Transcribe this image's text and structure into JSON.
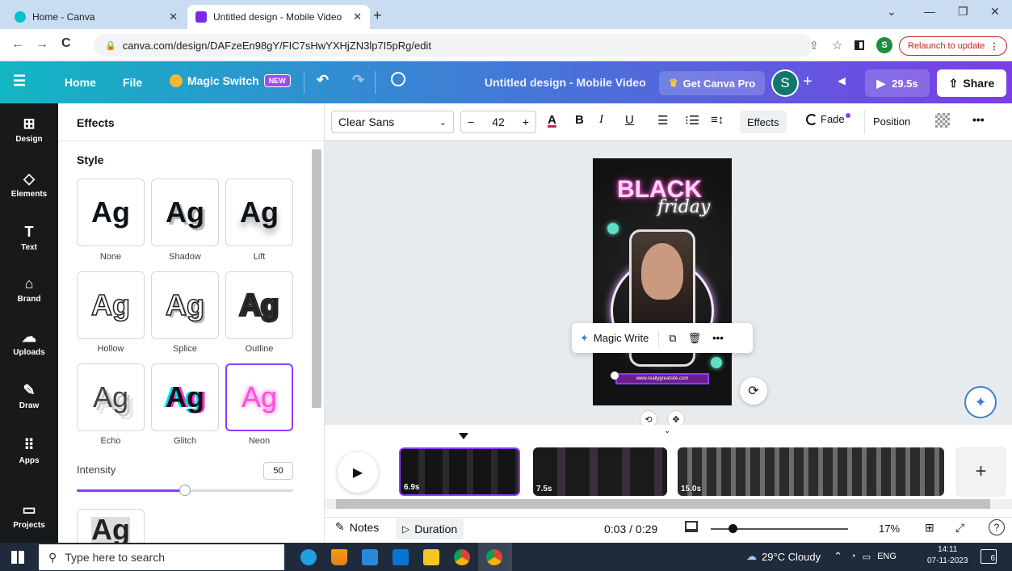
{
  "browser": {
    "tabs": [
      {
        "title": "Home - Canva"
      },
      {
        "title": "Untitled design - Mobile Video"
      }
    ],
    "url": "canva.com/design/DAFzeEn98gY/FIC7sHwYXHjZN3lp7I5pRg/edit",
    "relaunch": "Relaunch to update",
    "profile_initial": "S"
  },
  "header": {
    "home": "Home",
    "file": "File",
    "magic_switch": "Magic Switch",
    "new_badge": "NEW",
    "doc_title": "Untitled design - Mobile Video",
    "get_pro": "Get Canva Pro",
    "user_initial": "S",
    "play_duration": "29.5s",
    "share": "Share"
  },
  "rail": [
    {
      "label": "Design",
      "icon": "design-icon"
    },
    {
      "label": "Elements",
      "icon": "elements-icon"
    },
    {
      "label": "Text",
      "icon": "text-icon"
    },
    {
      "label": "Brand",
      "icon": "brand-icon"
    },
    {
      "label": "Uploads",
      "icon": "uploads-icon"
    },
    {
      "label": "Draw",
      "icon": "draw-icon"
    },
    {
      "label": "Apps",
      "icon": "apps-icon"
    },
    {
      "label": "Projects",
      "icon": "projects-icon"
    }
  ],
  "panel": {
    "title": "Effects",
    "style_heading": "Style",
    "sample": "Ag",
    "styles": [
      {
        "label": "None"
      },
      {
        "label": "Shadow"
      },
      {
        "label": "Lift"
      },
      {
        "label": "Hollow"
      },
      {
        "label": "Splice"
      },
      {
        "label": "Outline"
      },
      {
        "label": "Echo"
      },
      {
        "label": "Glitch"
      },
      {
        "label": "Neon",
        "selected": true
      }
    ],
    "intensity_label": "Intensity",
    "intensity_value": "50",
    "intensity_fraction": 0.5
  },
  "toolbar": {
    "font": "Clear Sans",
    "font_size": "42",
    "minus": "−",
    "plus": "+",
    "effects": "Effects",
    "fade": "Fade",
    "position": "Position",
    "more": "•••"
  },
  "design": {
    "headline": "BLACK",
    "script": "friday",
    "website": "www.reallygreatsite.com"
  },
  "magic_write": {
    "label": "Magic Write",
    "more": "•••"
  },
  "timeline": {
    "clips": [
      {
        "duration": "6.9s"
      },
      {
        "duration": "7.5s"
      },
      {
        "duration": "15.0s"
      }
    ],
    "add": "+"
  },
  "bottom": {
    "notes": "Notes",
    "duration": "Duration",
    "timecode": "0:03 / 0:29",
    "zoom": "17%",
    "help": "?"
  },
  "taskbar": {
    "search_placeholder": "Type here to search",
    "weather": "29°C  Cloudy",
    "lang": "ENG",
    "time": "14:11",
    "date": "07-11-2023",
    "notif_count": "6"
  },
  "colors": {
    "accent": "#8b3dff",
    "neon_pink": "#ff4fd8",
    "header_start": "#12b6c3",
    "header_end": "#7a3ee6"
  }
}
